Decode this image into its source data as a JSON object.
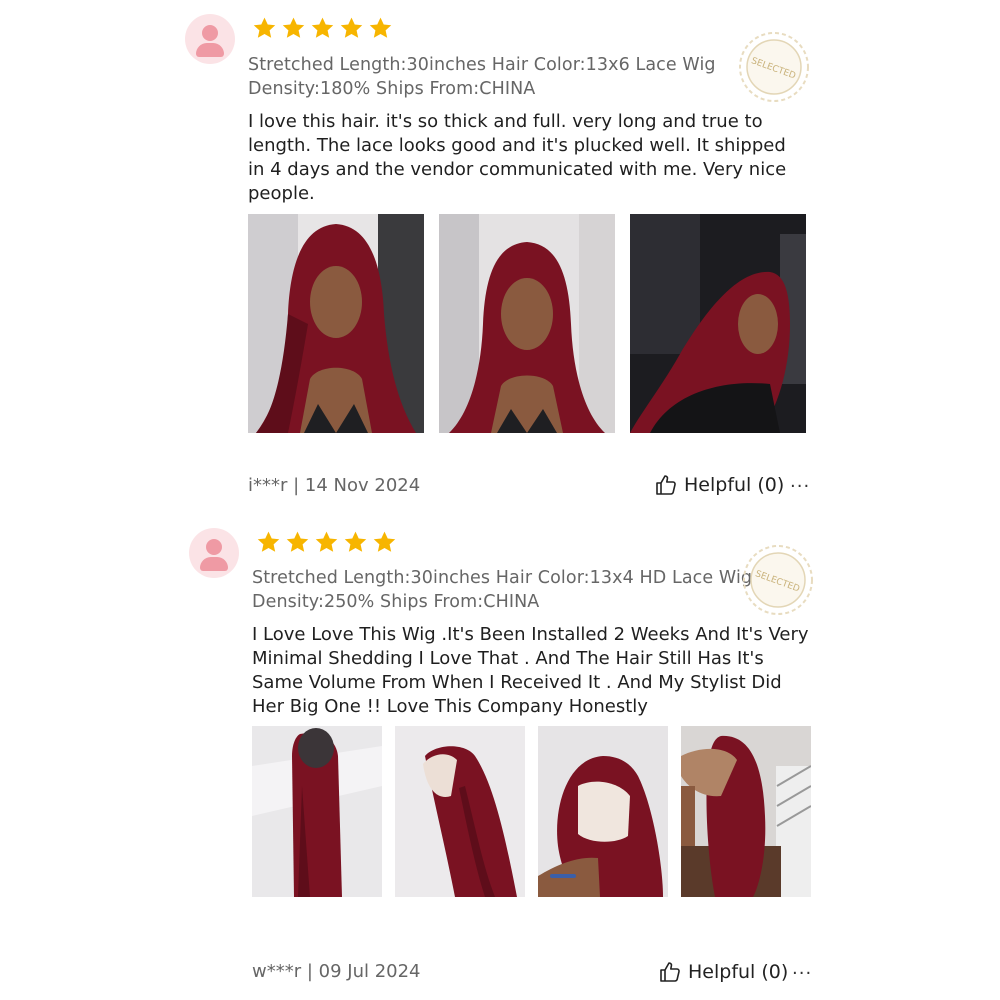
{
  "reviews": [
    {
      "stars": 5,
      "specs_line1": "Stretched Length:30inches Hair Color:13x6 Lace Wig",
      "specs_line2": "Density:180% Ships From:CHINA",
      "badge": "SELECTED",
      "text_lines": [
        "I love this hair. it's so thick and full. very long and true to",
        "length. The lace looks good and it's plucked well. It shipped",
        "in 4 days and the vendor communicated with me. Very nice",
        "people."
      ],
      "user_date": "i***r | 14 Nov 2024",
      "helpful_label": "Helpful (0)",
      "more_label": "···"
    },
    {
      "stars": 5,
      "specs_line1": "Stretched Length:30inches Hair Color:13x4 HD Lace Wig",
      "specs_line2": "Density:250% Ships From:CHINA",
      "badge": "SELECTED",
      "text_lines": [
        "I Love Love This Wig .It's Been Installed 2 Weeks And It's Very",
        "Minimal Shedding I Love That . And The Hair Still Has It's",
        "Same Volume From When I Received It . And My Stylist Did",
        "Her Big One !! Love This Company Honestly"
      ],
      "user_date": "w***r | 09 Jul 2024",
      "helpful_label": "Helpful (0)",
      "more_label": "···"
    }
  ],
  "colors": {
    "star": "#f7b500",
    "hair": "#7a1222",
    "avatar_bg": "#fbe3e6",
    "avatar_fg": "#ef9aa4",
    "seal": "#d9c8a0"
  },
  "icons": [
    "user-avatar-icon",
    "star-icon",
    "selected-seal-icon",
    "thumbs-up-icon",
    "more-icon"
  ]
}
